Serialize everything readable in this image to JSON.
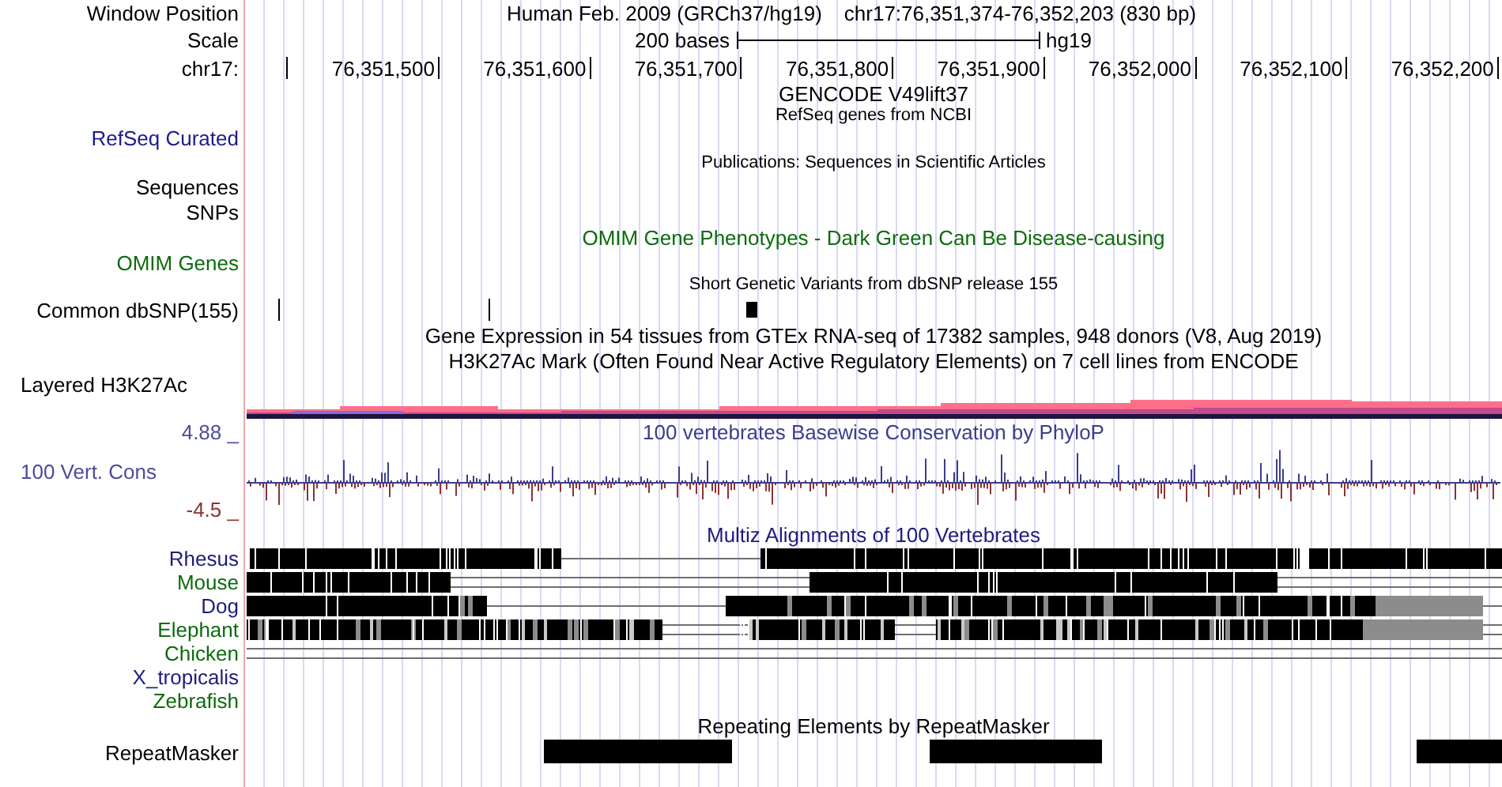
{
  "position_header": {
    "label": "Window Position",
    "title": "Human Feb. 2009 (GRCh37/hg19)",
    "position": "chr17:76,351,374-76,352,203 (830 bp)"
  },
  "scale": {
    "label": "Scale",
    "text": "200 bases",
    "assembly": "hg19"
  },
  "ruler": {
    "label": "chr17:",
    "ticks": [
      "76,351,500",
      "76,351,600",
      "76,351,700",
      "76,351,800",
      "76,351,900",
      "76,352,000",
      "76,352,100",
      "76,352,200"
    ]
  },
  "gencode": {
    "title": "GENCODE V49lift37"
  },
  "refseq": {
    "title": "RefSeq genes from NCBI",
    "label": "RefSeq Curated"
  },
  "publications": {
    "title": "Publications: Sequences in Scientific Articles",
    "labels": [
      "Sequences",
      "SNPs"
    ]
  },
  "omim": {
    "title": "OMIM Gene Phenotypes - Dark Green Can Be Disease-causing",
    "label": "OMIM Genes"
  },
  "dbsnp": {
    "title": "Short Genetic Variants from dbSNP release 155",
    "label": "Common dbSNP(155)"
  },
  "gtex": {
    "title": "Gene Expression in 54 tissues from GTEx RNA-seq of 17382 samples, 948 donors (V8, Aug 2019)"
  },
  "h3k27ac": {
    "title": "H3K27Ac Mark (Often Found Near Active Regulatory Elements) on 7 cell lines from ENCODE",
    "label": "Layered H3K27Ac"
  },
  "conservation": {
    "max": "4.88 _",
    "title": "100 vertebrates Basewise Conservation by PhyloP",
    "label": "100 Vert. Cons",
    "min": "-4.5 _"
  },
  "multiz": {
    "title": "Multiz Alignments of 100 Vertebrates",
    "species": [
      {
        "name": "Rhesus",
        "color": "#1c1c7c"
      },
      {
        "name": "Mouse",
        "color": "#0d6b0d"
      },
      {
        "name": "Dog",
        "color": "#1c1c7c"
      },
      {
        "name": "Elephant",
        "color": "#0d6b0d"
      },
      {
        "name": "Chicken",
        "color": "#0d6b0d"
      },
      {
        "name": "X_tropicalis",
        "color": "#1c1c7c"
      },
      {
        "name": "Zebrafish",
        "color": "#0d6b0d"
      }
    ]
  },
  "repeatmasker": {
    "title": "Repeating Elements by RepeatMasker",
    "label": "RepeatMasker"
  }
}
